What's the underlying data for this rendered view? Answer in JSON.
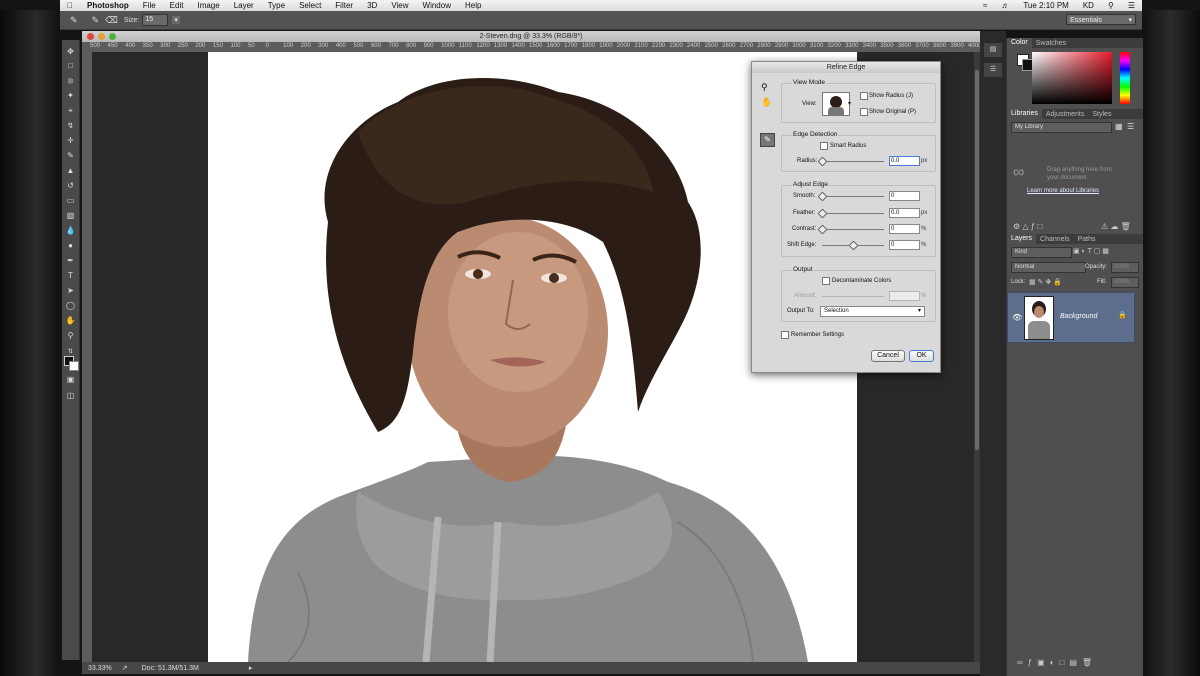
{
  "menubar": {
    "app_name": "Photoshop",
    "items": [
      "File",
      "Edit",
      "Image",
      "Layer",
      "Type",
      "Select",
      "Filter",
      "3D",
      "View",
      "Window",
      "Help"
    ],
    "status": [
      "Tue 2:10 PM",
      "KD"
    ]
  },
  "options_bar": {
    "size_label": "Size:",
    "size_value": "15",
    "workspace": "Essentials"
  },
  "document": {
    "title": "2-Steven.dng @ 33.3% (RGB/8*)",
    "ruler_ticks": [
      "500",
      "450",
      "400",
      "350",
      "300",
      "250",
      "200",
      "150",
      "100",
      "50",
      "0",
      "100",
      "200",
      "300",
      "400",
      "500",
      "600",
      "700",
      "800",
      "900",
      "1000",
      "1100",
      "1200",
      "1300",
      "1400",
      "1500",
      "1600",
      "1700",
      "1800",
      "1900",
      "2000",
      "2100",
      "2200",
      "2300",
      "2400",
      "2500",
      "2600",
      "2700",
      "2800",
      "2900",
      "3000",
      "3100",
      "3200",
      "3300",
      "3400",
      "3500",
      "3600",
      "3700",
      "3800",
      "3900",
      "4000"
    ],
    "zoom": "33.33%",
    "doc_size": "Doc: 51.3M/51.3M"
  },
  "dialog": {
    "title": "Refine Edge",
    "view_mode": {
      "heading": "View Mode",
      "view_label": "View:",
      "show_radius": "Show Radius (J)",
      "show_original": "Show Original (P)"
    },
    "edge_detection": {
      "heading": "Edge Detection",
      "smart_radius": "Smart Radius",
      "radius_label": "Radius:",
      "radius_value": "0.0",
      "radius_unit": "px",
      "radius_fraction": 0.0
    },
    "adjust_edge": {
      "heading": "Adjust Edge",
      "rows": [
        {
          "label": "Smooth:",
          "value": "0",
          "unit": "",
          "fraction": 0.0
        },
        {
          "label": "Feather:",
          "value": "0.0",
          "unit": "px",
          "fraction": 0.0
        },
        {
          "label": "Contrast:",
          "value": "0",
          "unit": "%",
          "fraction": 0.0
        },
        {
          "label": "Shift Edge:",
          "value": "0",
          "unit": "%",
          "fraction": 0.5
        }
      ]
    },
    "output": {
      "heading": "Output",
      "decontaminate": "Decontaminate Colors",
      "amount_label": "Amount:",
      "amount_unit": "%",
      "output_to_label": "Output To:",
      "output_to_value": "Selection"
    },
    "remember": "Remember Settings",
    "cancel": "Cancel",
    "ok": "OK"
  },
  "color_panel": {
    "tabs": [
      "Color",
      "Swatches"
    ]
  },
  "libraries_panel": {
    "tabs": [
      "Libraries",
      "Adjustments",
      "Styles"
    ],
    "library_select": "My Library",
    "empty_text_1": "Drag anything here from",
    "empty_text_2": "your document",
    "learn_link": "Learn more about Libraries"
  },
  "layers_panel": {
    "tabs": [
      "Layers",
      "Channels",
      "Paths"
    ],
    "filter_kind": "Kind",
    "blend_mode": "Normal",
    "opacity_label": "Opacity:",
    "opacity_value": "100%",
    "lock_label": "Lock:",
    "fill_label": "Fill:",
    "fill_value": "100%",
    "layer_name": "Background"
  },
  "colors": {
    "panel_bg": "#4f4f4f",
    "layer_selected": "#5d6e8c",
    "dialog_bg": "#d9d9d9",
    "hoodie": "#8f8f8f",
    "hair": "#2b1d15",
    "skin": "#b88a70"
  }
}
